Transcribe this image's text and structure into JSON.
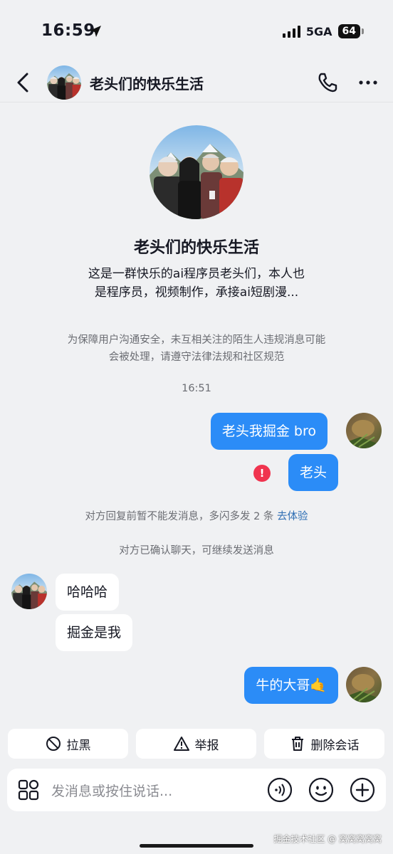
{
  "status_bar": {
    "time": "16:59",
    "network": "5GA",
    "battery": "64"
  },
  "header": {
    "title": "老头们的快乐生活"
  },
  "profile": {
    "name": "老头们的快乐生活",
    "bio_line1": "这是一群快乐的ai程序员老头们，本人也",
    "bio_line2": "是程序员，视频制作，承接ai短剧漫..."
  },
  "notice": {
    "line1": "为保障用户沟通安全，未互相关注的陌生人违规消息可能",
    "line2": "会被处理，请遵守法律法规和社区规范"
  },
  "timestamp": "16:51",
  "messages": [
    {
      "sender": "me",
      "text": "老头我掘金 bro"
    },
    {
      "sender": "me",
      "text": "老头",
      "failed": true
    },
    {
      "sender": "them",
      "text": "哈哈哈"
    },
    {
      "sender": "them",
      "text": "掘金是我"
    },
    {
      "sender": "me",
      "text": "牛的大哥🤙"
    }
  ],
  "system": {
    "limit_text": "对方回复前暂不能发消息，多闪多发 2 条",
    "limit_link": "去体验",
    "confirmed": "对方已确认聊天，可继续发送消息"
  },
  "actions": {
    "block": "拉黑",
    "report": "举报",
    "delete": "删除会话"
  },
  "input": {
    "placeholder": "发消息或按住说话..."
  },
  "watermark": "掘金技术社区 @ 窝窝窝窝窝",
  "colors": {
    "accent": "#2b8cf7",
    "background": "#f0f1f3",
    "error": "#f0344f",
    "link": "#2f6fb4"
  }
}
